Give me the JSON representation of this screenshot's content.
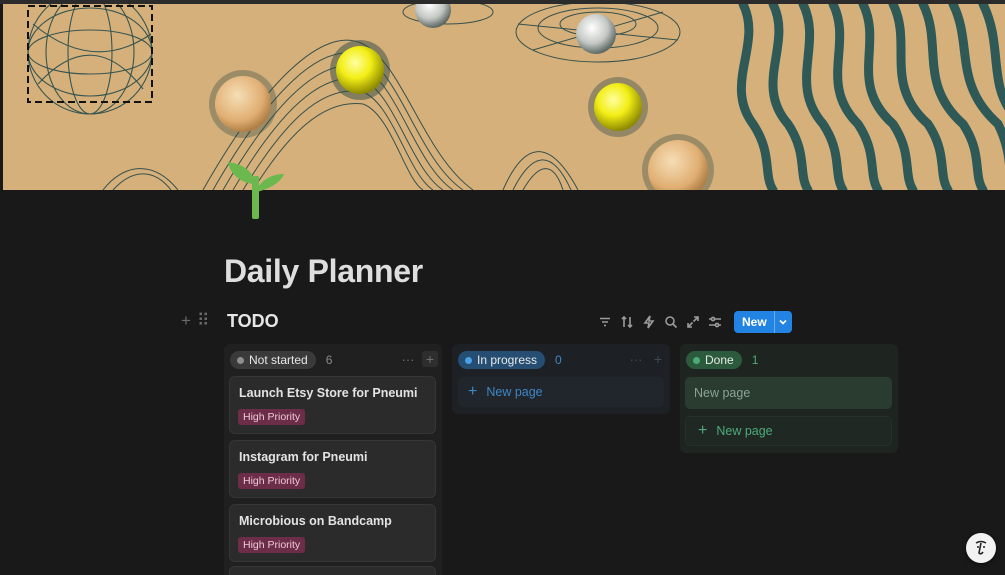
{
  "page": {
    "title": "Daily Planner",
    "icon": "seedling-icon",
    "cover": "abstract-orbs-wireframe-cover"
  },
  "database": {
    "title": "TODO",
    "toolbar": {
      "icons": [
        "filter-icon",
        "sort-icon",
        "automation-icon",
        "search-icon",
        "expand-icon",
        "settings-icon"
      ],
      "new_label": "New"
    }
  },
  "board": {
    "columns": [
      {
        "status": "Not started",
        "count": "6",
        "dot_color": "#8e8e8e",
        "cards": [
          {
            "title": "Launch Etsy Store for Pneumi",
            "tag": "High Priority"
          },
          {
            "title": "Instagram for Pneumi",
            "tag": "High Priority"
          },
          {
            "title": "Microbious on Bandcamp",
            "tag": "High Priority"
          }
        ]
      },
      {
        "status": "In progress",
        "count": "0",
        "dot_color": "#4aa1e6",
        "new_page_label": "New page"
      },
      {
        "status": "Done",
        "count": "1",
        "dot_color": "#4dab7a",
        "draft_label": "New page",
        "new_page_label": "New page"
      }
    ]
  },
  "colors": {
    "accent": "#2383e2",
    "background": "#191919",
    "tag_bg": "#6b2d48",
    "done_green": "#4dab7a"
  }
}
